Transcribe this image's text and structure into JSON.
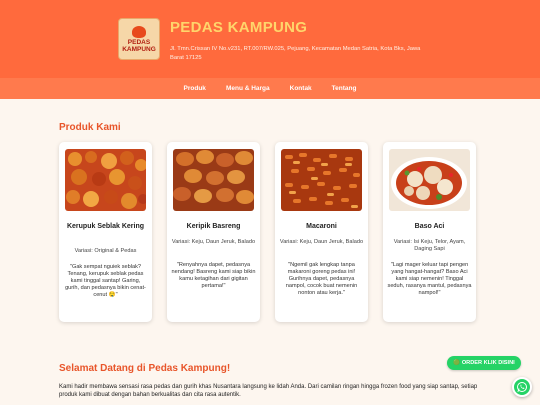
{
  "header": {
    "logo_text_line1": "PEDAS",
    "logo_text_line2": "KAMPUNG",
    "brand": "PEDAS KAMPUNG",
    "address": "Jl. Tmn.Crissan IV No.v231, RT.007/RW.025, Pejuang, Kecamatan Medan Satria, Kota Bks, Jawa Barat 17125"
  },
  "nav": {
    "items": [
      "Produk",
      "Menu & Harga",
      "Kontak",
      "Tentang"
    ]
  },
  "products": {
    "title": "Produk Kami",
    "items": [
      {
        "name": "Kerupuk Seblak Kering",
        "variant": "Variasi: Original & Pedas",
        "quote": "\"Gak sempat nguiek seblak? Tenang, kerupuk seblak pedas kami tinggal santap! Garing, gurih, dan pedasnya bikin cenat-cenut 🤤\"",
        "image": "spicy-crackers-photo"
      },
      {
        "name": "Keripik Basreng",
        "variant": "Variasi: Keju, Daun Jeruk, Balado",
        "quote": "\"Renyahnya dapet, pedasnya nendang! Basreng kami siap bikin kamu ketagihan dari gigitan pertama!\"",
        "image": "basreng-chips-photo"
      },
      {
        "name": "Macaroni",
        "variant": "Variasi: Keju, Daun Jeruk, Balado",
        "quote": "\"Ngemil gak lengkap tanpa makaroni goreng pedas ini! Gurihnya dapet, pedasnya nampol, cocok buat nemenin nonton atau kerja.\"",
        "image": "macaroni-snack-photo"
      },
      {
        "name": "Baso Aci",
        "variant": "Variasi: Isi Keju, Telor, Ayam, Daging Sapi",
        "quote": "\"Lagi mager keluar tapi pengen yang hangat-hangat? Baso Aci kami siap nemenin! Tinggal seduh, rasanya mantul, pedasnya nampol!\"",
        "image": "baso-aci-bowl-photo"
      }
    ]
  },
  "welcome": {
    "title": "Selamat Datang di Pedas Kampung!",
    "text": "Kami hadir membawa sensasi rasa pedas dan gurih khas Nusantara langsung ke lidah Anda. Dari camilan ringan hingga frozen food yang siap santap, setiap produk kami dibuat dengan bahan berkualitas dan cita rasa autentik."
  },
  "floating": {
    "order_label": "🟢 ORDER KLIK DISINI",
    "whatsapp_icon": "whatsapp-icon"
  },
  "colors": {
    "header_bg": "#ff6a3d",
    "nav_bg": "#ff7a4d",
    "brand_text": "#ffd56b",
    "accent": "#e8552a",
    "whatsapp": "#25d366"
  }
}
